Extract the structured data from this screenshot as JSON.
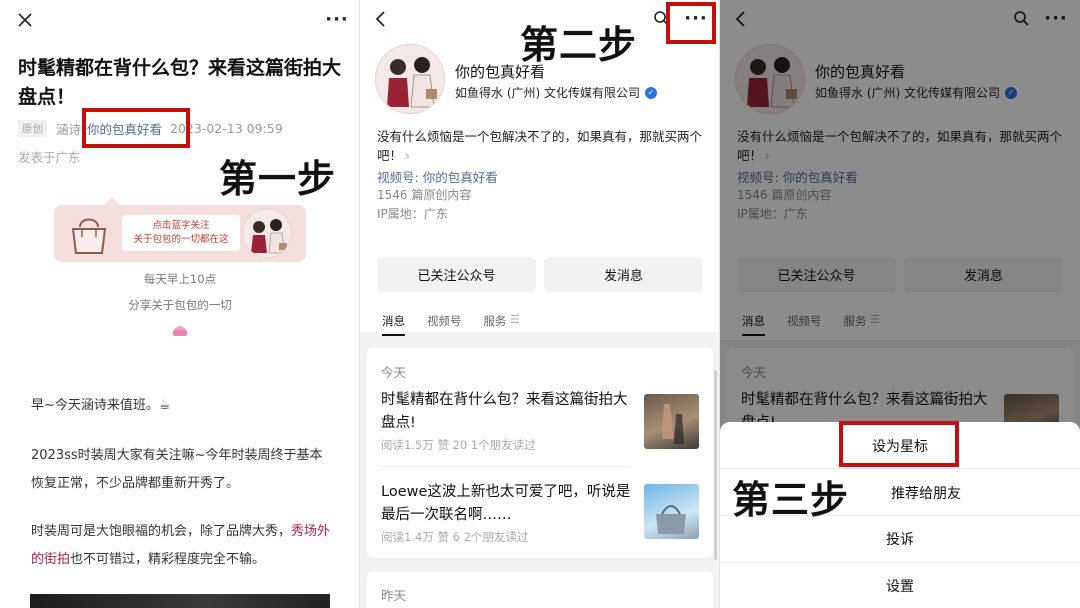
{
  "panel1": {
    "close_icon": "close-icon",
    "more_icon": "more-dots-icon",
    "article_title": "时髦精都在背什么包？来看这篇街拍大盘点！",
    "original_tag": "原创",
    "author": "涵诗",
    "account_link": "你的包真好看",
    "date": "2023-02-13 09:59",
    "published_in": "发表于广东",
    "step_label": "第一步",
    "banner_line1": "点击蓝字关注",
    "banner_line2": "关于包包的一切都在这",
    "daily_line": "每天早上10点",
    "share_line": "分享关于包包的一切",
    "para1": "早~今天涵诗来值班。☕",
    "para2": "2023ss时装周大家有关注嘛~今年时装周终于基本恢复正常，不少品牌都重新开秀了。",
    "para3_prefix": "时装周可是大饱眼福的机会，除了品牌大秀，",
    "para3_highlight": "秀场外的街拍",
    "para3_suffix": "也不可错过，精彩程度完全不输。"
  },
  "panel2": {
    "back_icon": "back-chevron-icon",
    "search_icon": "search-icon",
    "more_icon": "more-dots-icon",
    "step_label": "第二步",
    "account_name": "你的包真好看",
    "company": "如鱼得水 (广州) 文化传媒有限公司",
    "description": "没有什么烦恼是一个包解决不了的，如果真有，那就买两个吧！",
    "channel_prefix": "视频号: ",
    "channel_name": "你的包真好看",
    "original_count": "1546 篇原创内容",
    "ip_location": "IP属地：广东",
    "followed_button": "已关注公众号",
    "message_button": "发消息",
    "tabs": [
      "消息",
      "视频号",
      "服务"
    ],
    "section_today": "今天",
    "section_yesterday": "昨天",
    "posts": [
      {
        "title": "时髦精都在背什么包？来看这篇街拍大盘点!",
        "meta": "阅读1.5万  赞 20  1个朋友读过"
      },
      {
        "title": "Loewe这波上新也太可爱了吧，听说是最后一次联名啊……",
        "meta": "阅读1.4万  赞 6  2个朋友读过"
      }
    ]
  },
  "panel3": {
    "step_label": "第三步",
    "account_name": "你的包真好看",
    "company": "如鱼得水 (广州) 文化传媒有限公司",
    "description": "没有什么烦恼是一个包解决不了的，如果真有，那就买两个吧！",
    "channel_prefix": "视频号: ",
    "channel_name": "你的包真好看",
    "original_count": "1546 篇原创内容",
    "ip_location": "IP属地：广东",
    "followed_button": "已关注公众号",
    "message_button": "发消息",
    "tabs": [
      "消息",
      "视频号",
      "服务"
    ],
    "section_today": "今天",
    "post_title": "时髦精都在背什么包？来看这篇街拍大盘点!",
    "sheet": {
      "star": "设为星标",
      "recommend": "推荐给朋友",
      "report": "投诉",
      "settings": "设置"
    }
  },
  "colors": {
    "highlight_red": "#c40f0f",
    "link_blue": "#576b95",
    "verified_blue": "#2c72e6",
    "banner_pink": "#f5dede"
  }
}
